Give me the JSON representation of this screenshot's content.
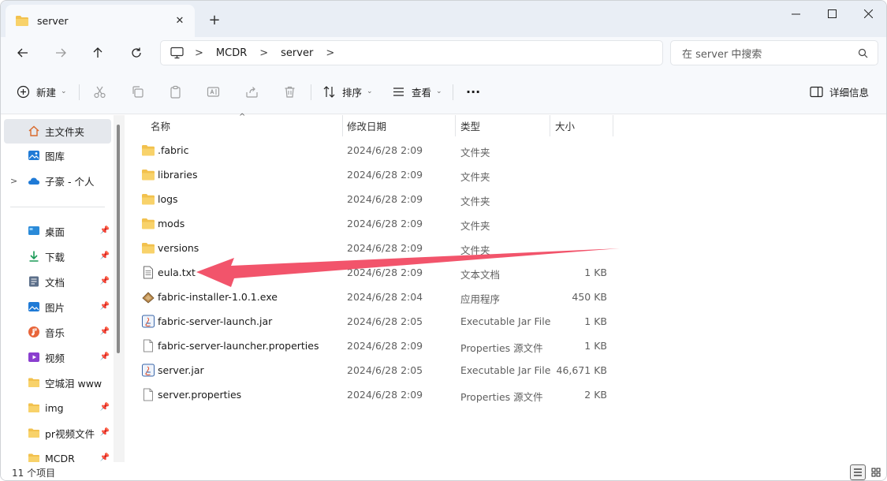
{
  "tab": {
    "title": "server"
  },
  "window_controls": {
    "minimize": "—",
    "maximize": "☐",
    "close": "✕"
  },
  "address": {
    "crumbs": [
      "MCDR",
      "server"
    ]
  },
  "search": {
    "placeholder": "在 server 中搜索"
  },
  "toolbar": {
    "new_label": "新建",
    "sort_label": "排序",
    "view_label": "查看",
    "more_label": "···",
    "details_label": "详细信息"
  },
  "sidebar": {
    "top_items": [
      {
        "label": "主文件夹",
        "icon": "home-icon",
        "selected": true
      },
      {
        "label": "图库",
        "icon": "gallery-icon"
      },
      {
        "label": "子豪 - 个人",
        "icon": "onedrive-cloud-icon"
      }
    ],
    "pinned_items": [
      {
        "label": "桌面",
        "icon": "desktop-icon"
      },
      {
        "label": "下载",
        "icon": "download-icon"
      },
      {
        "label": "文档",
        "icon": "document-icon"
      },
      {
        "label": "图片",
        "icon": "pictures-icon"
      },
      {
        "label": "音乐",
        "icon": "music-icon"
      },
      {
        "label": "视频",
        "icon": "video-icon"
      },
      {
        "label": "空城泪 www",
        "icon": "folder-icon"
      },
      {
        "label": "img",
        "icon": "folder-icon"
      },
      {
        "label": "pr视频文件",
        "icon": "folder-icon"
      },
      {
        "label": "MCDR",
        "icon": "folder-icon"
      }
    ]
  },
  "columns": {
    "name": "名称",
    "modified": "修改日期",
    "type": "类型",
    "size": "大小"
  },
  "files": [
    {
      "name": ".fabric",
      "date": "2024/6/28 2:09",
      "type": "文件夹",
      "size": "",
      "icon": "folder"
    },
    {
      "name": "libraries",
      "date": "2024/6/28 2:09",
      "type": "文件夹",
      "size": "",
      "icon": "folder"
    },
    {
      "name": "logs",
      "date": "2024/6/28 2:09",
      "type": "文件夹",
      "size": "",
      "icon": "folder"
    },
    {
      "name": "mods",
      "date": "2024/6/28 2:09",
      "type": "文件夹",
      "size": "",
      "icon": "folder"
    },
    {
      "name": "versions",
      "date": "2024/6/28 2:09",
      "type": "文件夹",
      "size": "",
      "icon": "folder"
    },
    {
      "name": "eula.txt",
      "date": "2024/6/28 2:09",
      "type": "文本文档",
      "size": "1 KB",
      "icon": "text"
    },
    {
      "name": "fabric-installer-1.0.1.exe",
      "date": "2024/6/28 2:04",
      "type": "应用程序",
      "size": "450 KB",
      "icon": "exe"
    },
    {
      "name": "fabric-server-launch.jar",
      "date": "2024/6/28 2:05",
      "type": "Executable Jar File",
      "size": "1 KB",
      "icon": "jar"
    },
    {
      "name": "fabric-server-launcher.properties",
      "date": "2024/6/28 2:09",
      "type": "Properties 源文件",
      "size": "1 KB",
      "icon": "doc"
    },
    {
      "name": "server.jar",
      "date": "2024/6/28 2:05",
      "type": "Executable Jar File",
      "size": "46,671 KB",
      "icon": "jar"
    },
    {
      "name": "server.properties",
      "date": "2024/6/28 2:09",
      "type": "Properties 源文件",
      "size": "2 KB",
      "icon": "doc"
    }
  ],
  "status": {
    "count": "11 个项目"
  },
  "colors": {
    "accent": "#0067c0",
    "folder": "#f2c14e",
    "annotation": "#f2546b"
  }
}
